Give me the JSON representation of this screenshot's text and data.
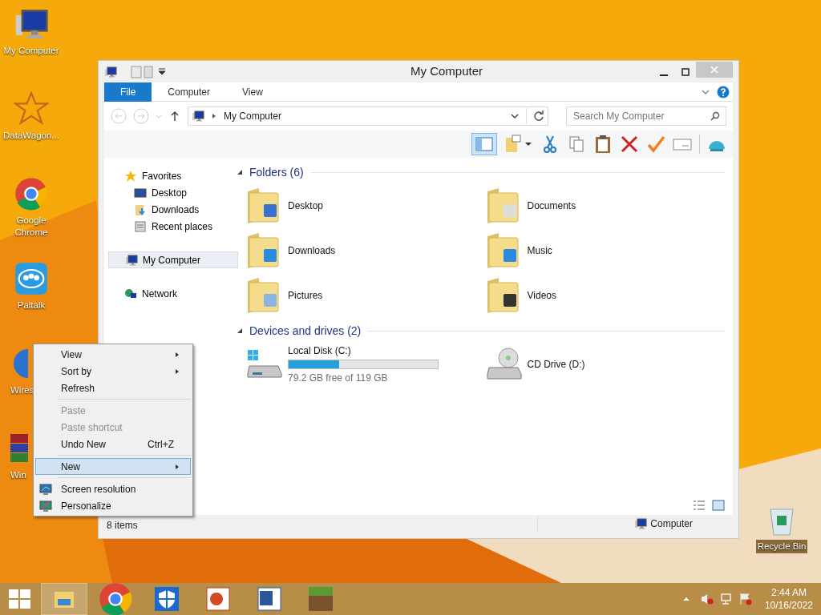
{
  "desktop_icons": [
    {
      "label": "My Computer",
      "kind": "computer"
    },
    {
      "label": "DataWagon...",
      "kind": "star"
    },
    {
      "label": "Google Chrome",
      "kind": "chrome"
    },
    {
      "label": "Paltalk",
      "kind": "chat"
    },
    {
      "label": "Wires",
      "kind": "globe"
    },
    {
      "label": "Win",
      "kind": "books"
    }
  ],
  "recycle_bin": {
    "label": "Recycle Bin"
  },
  "window": {
    "title": "My Computer",
    "ribbon_tabs": [
      {
        "label": "File",
        "selected": true
      },
      {
        "label": "Computer",
        "selected": false
      },
      {
        "label": "View",
        "selected": false
      }
    ],
    "address": "My Computer",
    "search": {
      "placeholder": "Search My Computer"
    },
    "nav": [
      {
        "label": "Favorites",
        "kind": "star",
        "selected": false,
        "children": [
          {
            "label": "Desktop",
            "kind": "desktop",
            "selected": false
          },
          {
            "label": "Downloads",
            "kind": "downloads",
            "selected": false
          },
          {
            "label": "Recent places",
            "kind": "recent",
            "selected": false
          }
        ]
      },
      {
        "label": "My Computer",
        "kind": "computer",
        "selected": true
      },
      {
        "label": "Network",
        "kind": "network",
        "selected": false
      }
    ],
    "groups": [
      {
        "title": "Folders (6)",
        "items": [
          {
            "label": "Desktop",
            "kind": "desktop"
          },
          {
            "label": "Documents",
            "kind": "documents"
          },
          {
            "label": "Downloads",
            "kind": "downloads"
          },
          {
            "label": "Music",
            "kind": "music"
          },
          {
            "label": "Pictures",
            "kind": "pictures"
          },
          {
            "label": "Videos",
            "kind": "videos"
          }
        ]
      },
      {
        "title": "Devices and drives (2)",
        "items": [
          {
            "label": "Local Disk (C:)",
            "kind": "disk",
            "level": 0.34,
            "detail": "79.2 GB free of 119 GB"
          },
          {
            "label": "CD Drive (D:)",
            "kind": "cd"
          }
        ]
      }
    ],
    "status_left": "8 items",
    "status_right": "Computer"
  },
  "context_menu": [
    {
      "kind": "submenu",
      "label": "View",
      "disabled": false,
      "selected": false
    },
    {
      "kind": "submenu",
      "label": "Sort by",
      "disabled": false,
      "selected": false
    },
    {
      "kind": "command",
      "label": "Refresh",
      "disabled": false,
      "selected": false
    },
    {
      "kind": "separator"
    },
    {
      "kind": "command",
      "label": "Paste",
      "disabled": true,
      "selected": false
    },
    {
      "kind": "command",
      "label": "Paste shortcut",
      "disabled": true,
      "selected": false
    },
    {
      "kind": "command",
      "label": "Undo New",
      "shortcut": "Ctrl+Z",
      "disabled": false,
      "selected": false
    },
    {
      "kind": "separator"
    },
    {
      "kind": "submenu",
      "label": "New",
      "disabled": false,
      "selected": true
    },
    {
      "kind": "separator"
    },
    {
      "kind": "display",
      "label": "Screen resolution",
      "disabled": false,
      "selected": false
    },
    {
      "kind": "personalize",
      "label": "Personalize",
      "disabled": false,
      "selected": false
    }
  ],
  "taskbar": {
    "apps": [
      {
        "kind": "explorer",
        "selected": true
      },
      {
        "kind": "chrome",
        "selected": false
      },
      {
        "kind": "shield",
        "selected": false
      },
      {
        "kind": "slides",
        "selected": false
      },
      {
        "kind": "word",
        "selected": false
      },
      {
        "kind": "block",
        "selected": false
      }
    ],
    "time": "2:44 AM",
    "date": "10/16/2022"
  }
}
